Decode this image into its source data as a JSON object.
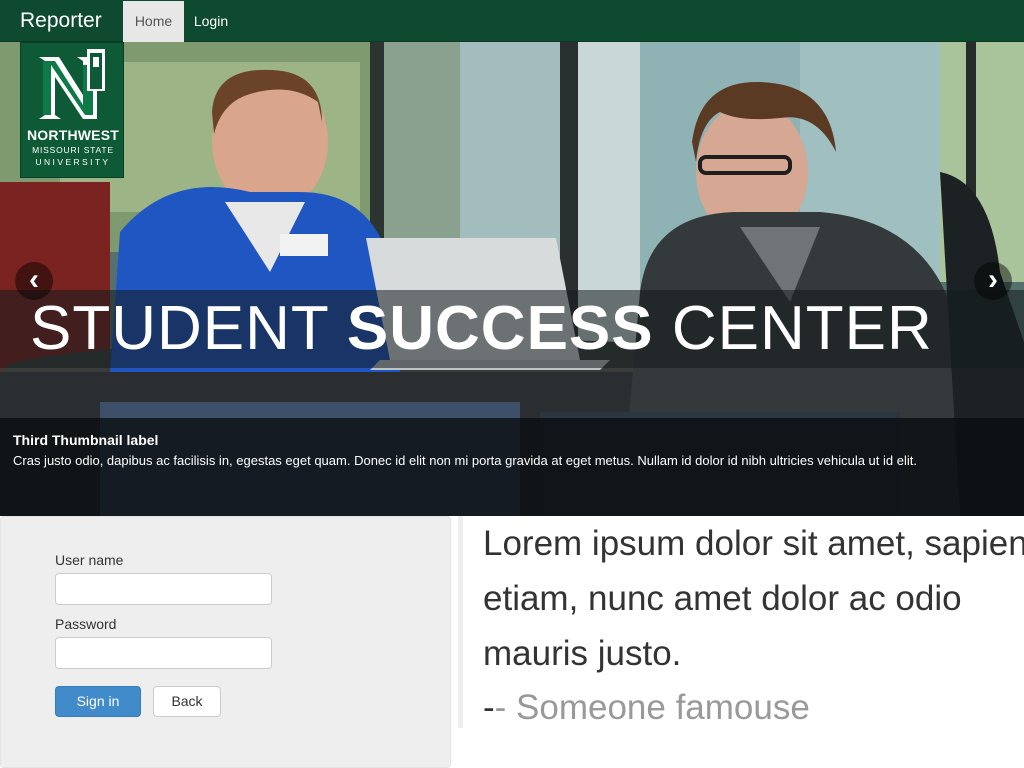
{
  "navbar": {
    "brand": "Reporter",
    "items": [
      {
        "label": "Home",
        "active": true
      },
      {
        "label": "Login",
        "active": false
      }
    ],
    "background_color": "#0e4a2f"
  },
  "carousel": {
    "logo": {
      "wordmark": "NORTHWEST",
      "line1": "MISSOURI STATE",
      "line2": "UNIVERSITY",
      "mark": "N"
    },
    "banner": {
      "part1": "STUDENT",
      "part2": "SUCCESS",
      "part3": "CENTER"
    },
    "prev_icon": "‹",
    "next_icon": "›",
    "caption": {
      "title": "Third Thumbnail label",
      "text": "Cras justo odio, dapibus ac facilisis in, egestas eget quam. Donec id elit non mi porta gravida at eget metus. Nullam id dolor id nibh ultricies vehicula ut id elit."
    }
  },
  "login_form": {
    "username_label": "User name",
    "username_value": "",
    "password_label": "Password",
    "password_value": "",
    "signin_label": "Sign in",
    "back_label": "Back",
    "primary_color": "#428bca"
  },
  "quote": {
    "text": "Lorem ipsum dolor sit amet, sapien etiam, nunc amet dolor ac odio mauris justo.",
    "dash": "-",
    "attribution": "- Someone famouse"
  },
  "icons": {
    "prev": "chevron-left-icon",
    "next": "chevron-right-icon",
    "logo": "northwest-logo"
  }
}
